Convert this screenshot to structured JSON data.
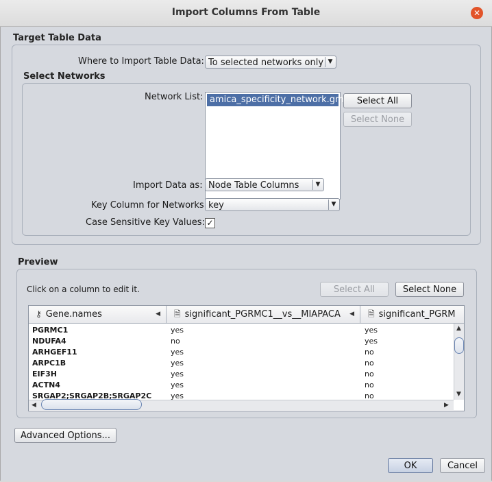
{
  "window": {
    "title": "Import Columns From Table",
    "close_symbol": "✕"
  },
  "target_table": {
    "section_label": "Target Table Data",
    "where_label": "Where to Import Table Data:",
    "where_value": "To selected networks only"
  },
  "select_networks": {
    "section_label": "Select Networks",
    "network_list_label": "Network List:",
    "networks": [
      "amica_specificity_network.gml"
    ],
    "select_all_label": "Select All",
    "select_none_label": "Select None",
    "import_as_label": "Import Data as:",
    "import_as_value": "Node Table Columns",
    "key_column_label": "Key Column for Networks:",
    "key_column_value": "key",
    "case_sensitive_label": "Case Sensitive Key Values:",
    "case_sensitive_checked": true
  },
  "preview": {
    "section_label": "Preview",
    "hint": "Click on a column to edit it.",
    "select_all_label": "Select All",
    "select_none_label": "Select None",
    "columns": [
      "Gene.names",
      "significant_PGRMC1__vs__MIAPACA",
      "significant_PGRM"
    ],
    "rows": [
      [
        "PGRMC1",
        "yes",
        "yes"
      ],
      [
        "NDUFA4",
        "no",
        "yes"
      ],
      [
        "ARHGEF11",
        "yes",
        "no"
      ],
      [
        "ARPC1B",
        "yes",
        "no"
      ],
      [
        "EIF3H",
        "yes",
        "no"
      ],
      [
        "ACTN4",
        "yes",
        "no"
      ],
      [
        "SRGAP2;SRGAP2B;SRGAP2C",
        "yes",
        "no"
      ]
    ]
  },
  "footer": {
    "advanced_label": "Advanced Options...",
    "ok_label": "OK",
    "cancel_label": "Cancel"
  }
}
